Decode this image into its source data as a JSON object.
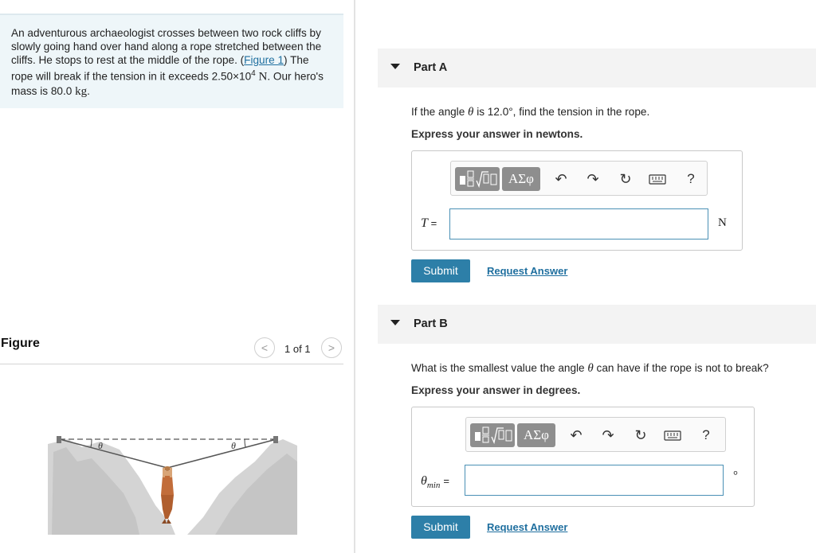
{
  "problem": {
    "line1": "An adventurous archaeologist crosses between two rock cliffs by",
    "line2": "slowly going hand over hand along a rope stretched between the",
    "line3_pre": "cliffs. He stops to rest at the middle of the rope. (",
    "figure_link": "Figure 1",
    "line3_post": ") The",
    "line4_pre": "rope will break if the tension in it exceeds 2.50×10",
    "line4_exp": "4",
    "line4_unit": "N",
    "line4_post": ". Our hero's",
    "line5_pre": "mass is 80.0 ",
    "line5_unit": "kg",
    "line5_post": "."
  },
  "figure": {
    "title": "Figure",
    "pager": "1 of 1",
    "prev_icon": "<",
    "next_icon": ">",
    "theta": "θ"
  },
  "part_a": {
    "title": "Part A",
    "question_pre": "If the angle ",
    "question_var": "θ",
    "question_post": " is 12.0°, find the tension in the rope.",
    "express": "Express your answer in newtons.",
    "var_label": "T",
    "equals": "=",
    "unit": "N",
    "submit": "Submit",
    "request": "Request Answer"
  },
  "part_b": {
    "title": "Part B",
    "question_pre": "What is the smallest value the angle ",
    "question_var": "θ",
    "question_post": " can have if the rope is not to break?",
    "express": "Express your answer in degrees.",
    "var_label": "θ",
    "var_sub": "min",
    "equals": "=",
    "unit": "°",
    "submit": "Submit",
    "request": "Request Answer"
  },
  "toolbar": {
    "greek": "ΑΣφ",
    "help": "?"
  }
}
